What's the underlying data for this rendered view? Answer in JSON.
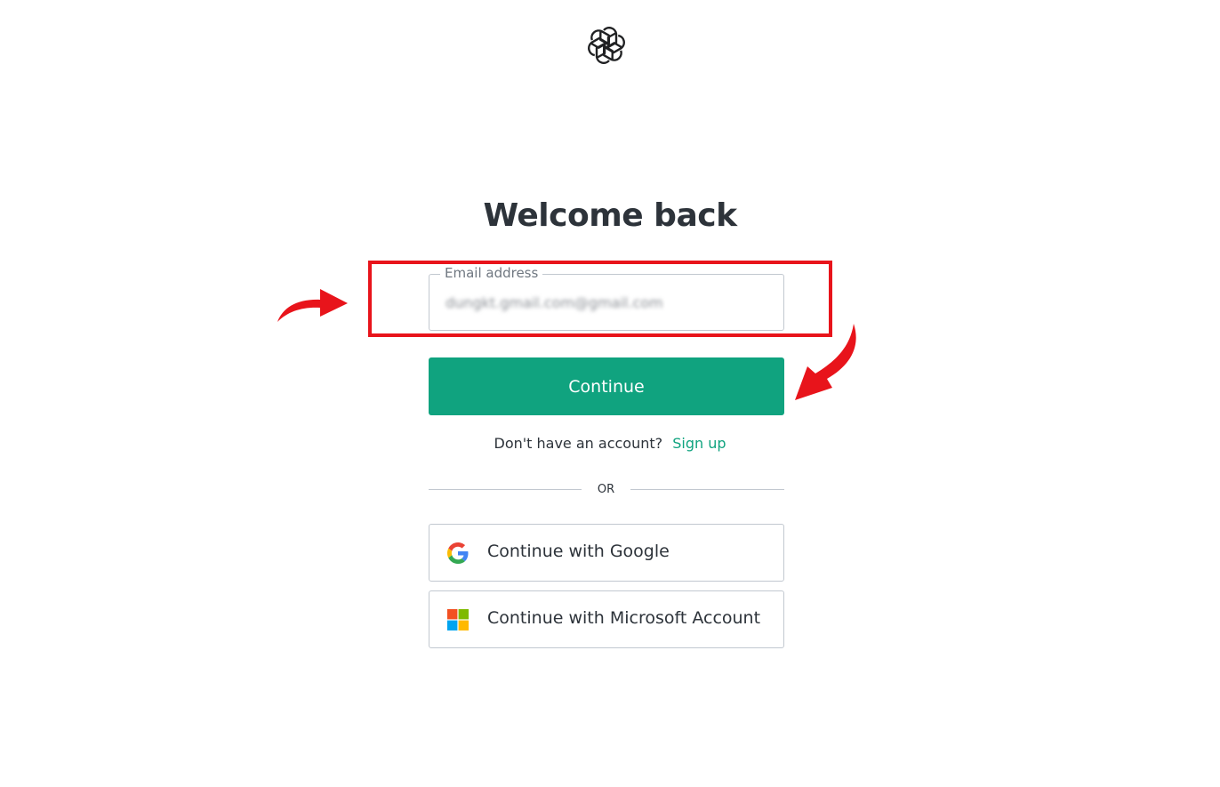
{
  "logo": {
    "icon": "openai-logo-icon"
  },
  "heading": {
    "title": "Welcome back"
  },
  "email": {
    "label": "Email address",
    "value": "dungkt.gmail.com@gmail.com"
  },
  "continue": {
    "label": "Continue"
  },
  "signup": {
    "prompt": "Don't have an account?",
    "link": "Sign up"
  },
  "divider": {
    "text": "OR"
  },
  "social": {
    "google_label": "Continue with Google",
    "google_icon": "google-icon",
    "microsoft_label": "Continue with Microsoft Account",
    "microsoft_icon": "microsoft-icon"
  },
  "colors": {
    "accent": "#10a37f",
    "annotation": "#e8141b",
    "text": "#2d333a"
  }
}
